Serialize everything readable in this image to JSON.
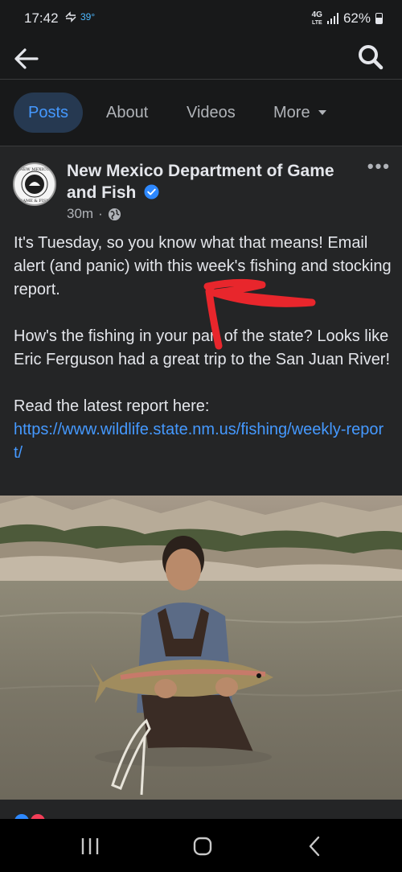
{
  "status_bar": {
    "time": "17:42",
    "temperature": "39°",
    "network": "4G",
    "network_sub": "LTE",
    "battery": "62%"
  },
  "tabs": [
    {
      "label": "Posts",
      "active": true
    },
    {
      "label": "About"
    },
    {
      "label": "Videos"
    },
    {
      "label": "More"
    }
  ],
  "post": {
    "page_name": "New Mexico Department of Game and Fish",
    "time_ago": "30m",
    "separator": "·",
    "avatar_text_top": "NEW MEXICO",
    "avatar_text_bottom": "GAME & FISH",
    "paragraphs": [
      "It's Tuesday, so you know what that means! Email alert (and panic) with this week's fishing and stocking report.",
      "How's the fishing in your part of the state? Looks like Eric Ferguson had a great trip to the San Juan River!",
      "Read the latest report here:"
    ],
    "link": "https://www.wildlife.state.nm.us/fishing/weekly-report/",
    "more_options": "•••"
  },
  "icons": {
    "back": "arrow-left-icon",
    "search": "search-icon",
    "verified": "verified-badge-icon",
    "privacy": "globe-icon",
    "more_caret": "caret-down-icon",
    "nav_recents": "recents-icon",
    "nav_home": "home-icon",
    "nav_back": "back-chevron-icon"
  },
  "colors": {
    "accent": "#4599ff",
    "background": "#242526",
    "annotation_arrow": "#e8262c"
  }
}
